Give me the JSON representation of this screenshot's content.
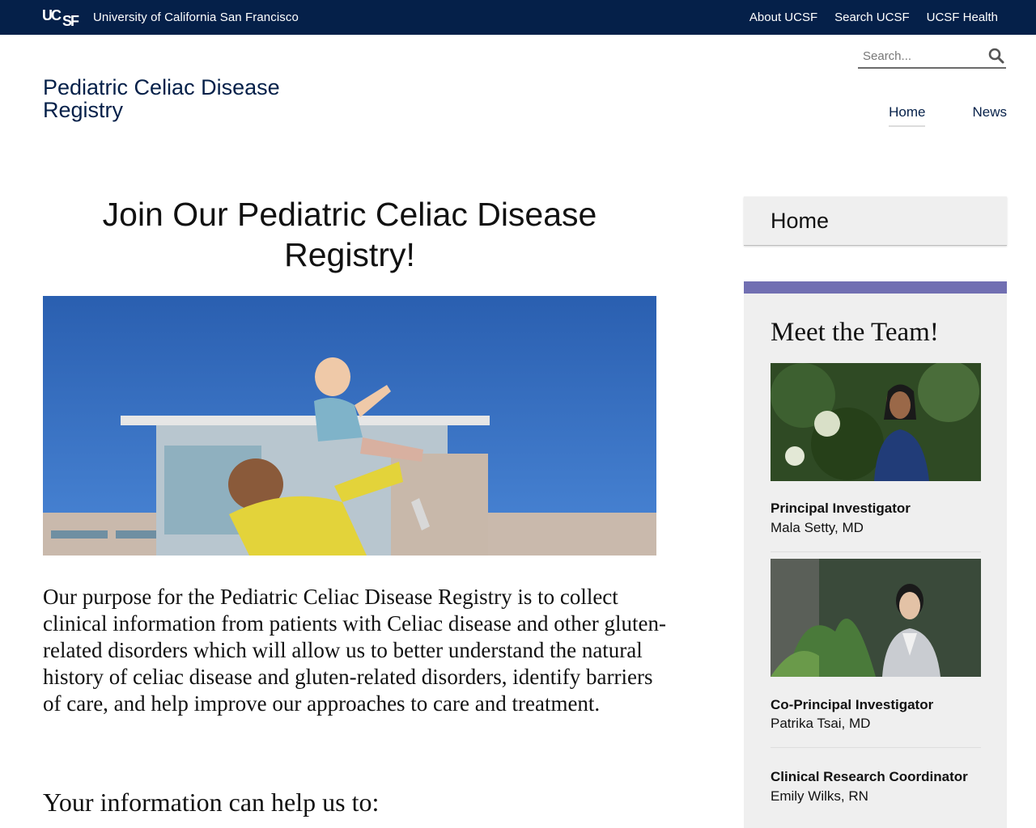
{
  "topbar": {
    "logo_text": "UCSF",
    "university": "University of California San Francisco",
    "links": [
      "About UCSF",
      "Search UCSF",
      "UCSF Health"
    ]
  },
  "header": {
    "site_title": "Pediatric Celiac Disease Registry",
    "search_placeholder": "Search...",
    "nav": [
      {
        "label": "Home",
        "active": true
      },
      {
        "label": "News",
        "active": false
      }
    ]
  },
  "main": {
    "heading": "Join Our Pediatric Celiac Disease Registry!",
    "intro": "Our purpose for the Pediatric Celiac Disease Registry is to collect clinical information from patients with Celiac disease and other gluten-related disorders which will allow us to better understand the natural history of celiac disease and gluten-related disorders,  identify barriers of care, and help improve our approaches to care and treatment.",
    "subheading": "Your information can help us to:"
  },
  "sidebar": {
    "home_label": "Home",
    "team_title": "Meet the Team!",
    "members": [
      {
        "role": "Principal Investigator",
        "name": "Mala Setty, MD"
      },
      {
        "role": "Co-Principal Investigator",
        "name": "Patrika Tsai, MD"
      },
      {
        "role": "Clinical Research Coordinator",
        "name": "Emily Wilks, RN"
      }
    ]
  },
  "colors": {
    "topbar": "#052049",
    "accent": "#716fb2",
    "sidebar_bg": "#efefef"
  }
}
